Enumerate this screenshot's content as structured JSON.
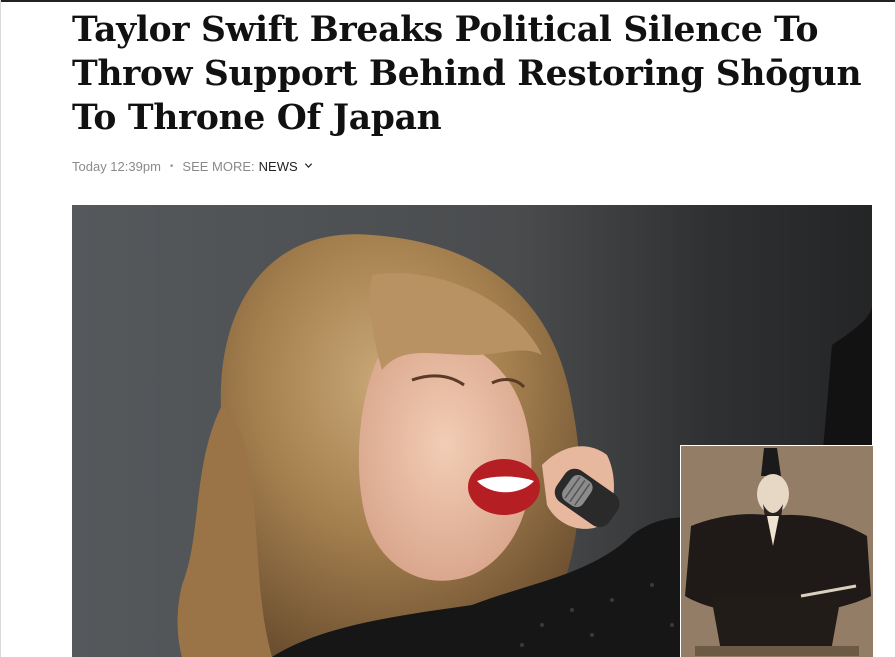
{
  "article": {
    "headline": "Taylor Swift Breaks Political Silence To Throw Support Behind Restoring Shōgun To Throne Of Japan",
    "timestamp": "Today 12:39pm",
    "see_more_label": "SEE MORE:",
    "section_label": "NEWS",
    "section_icon": "chevron-down-icon"
  },
  "media": {
    "hero_image": "photo-singer-performing-with-microphone",
    "inset_image": "painting-shogun-portrait"
  },
  "colors": {
    "headline": "#111111",
    "meta_text": "#8a8a8a",
    "section_link": "#222222",
    "hero_background": "#4a4b4c",
    "inset_background": "#8a7560"
  }
}
